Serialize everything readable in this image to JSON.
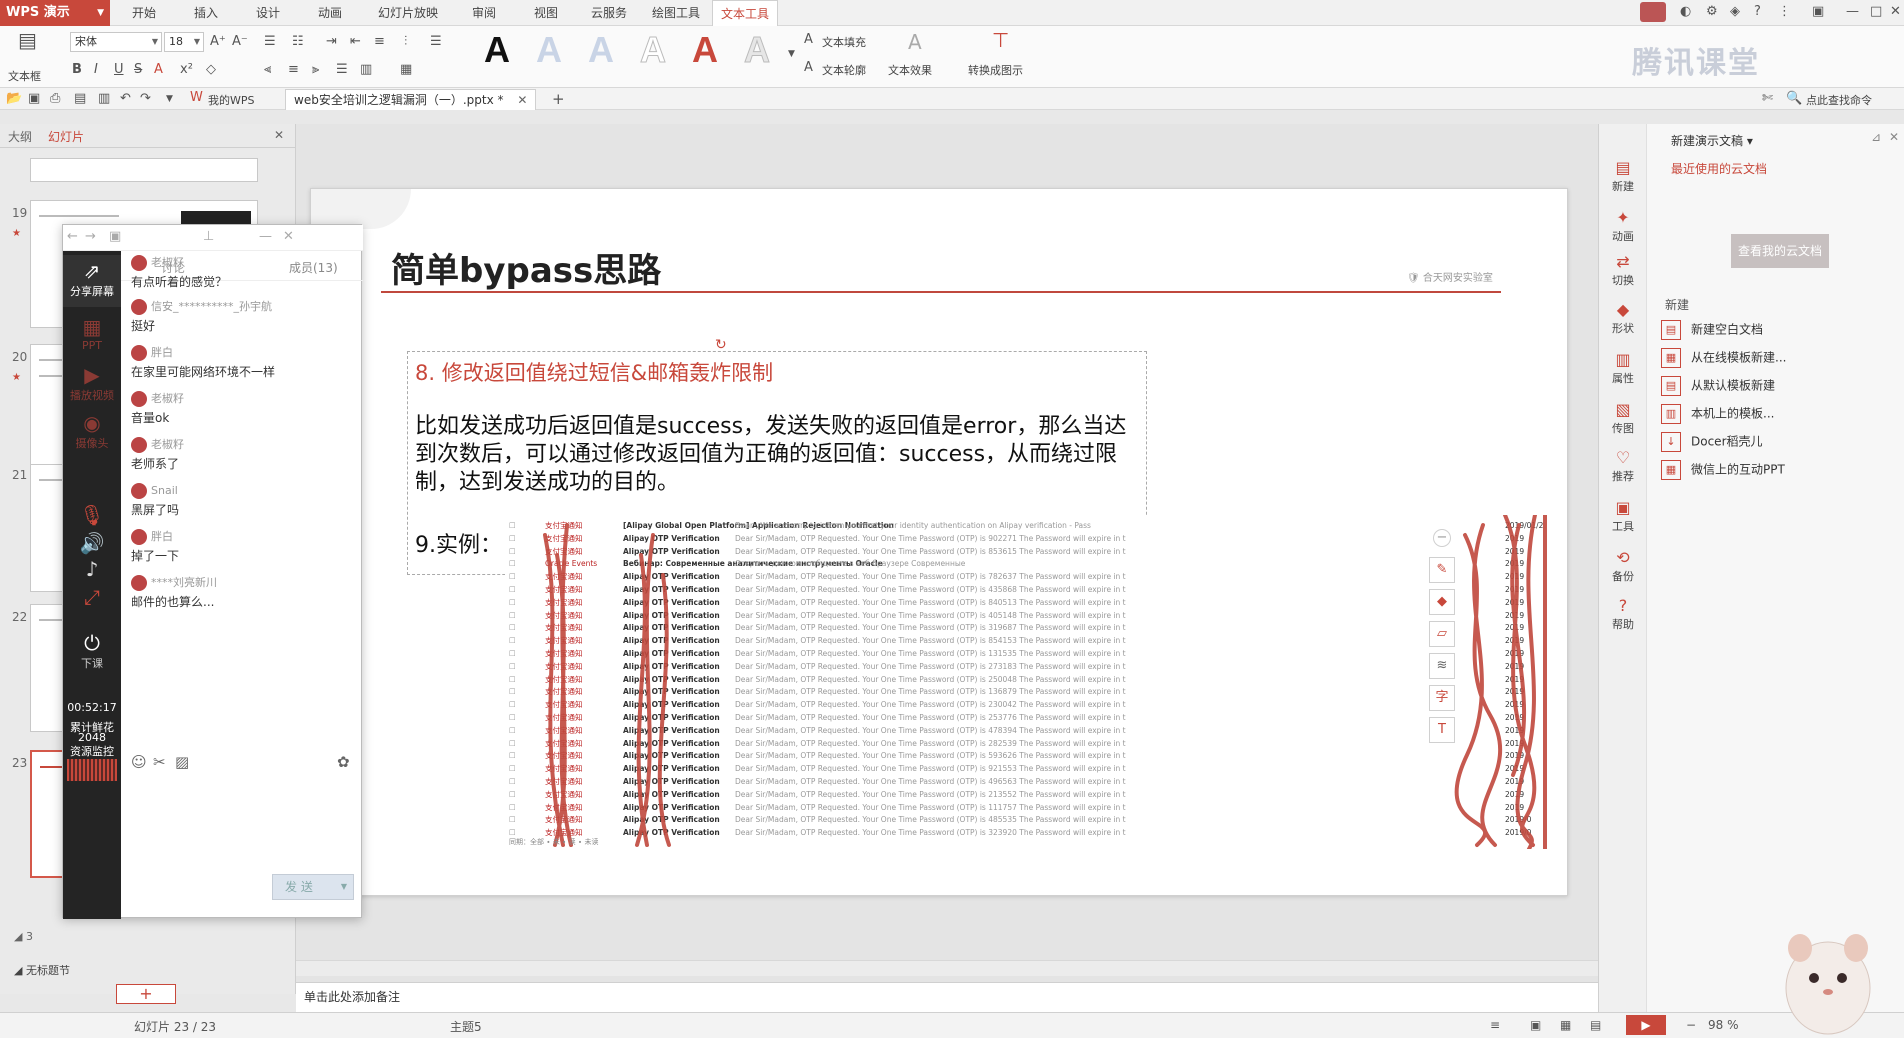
{
  "app": {
    "name": "WPS 演示"
  },
  "ribbon_tabs": [
    "开始",
    "插入",
    "设计",
    "动画",
    "幻灯片放映",
    "审阅",
    "视图",
    "云服务",
    "绘图工具",
    "文本工具"
  ],
  "ribbon": {
    "textbox_label": "文本框",
    "font_name": "宋体",
    "font_size": "18",
    "fill_label": "文本填充",
    "outline_label": "文本轮廓",
    "effect_label": "文本效果",
    "convert_label": "转换成图示",
    "wordart_colors": [
      "#111111",
      "#c9d4e6",
      "#c9d4e6",
      "#e8e8e8",
      "#c8483b",
      "#e6e6e6"
    ]
  },
  "qbar": {
    "mywps_label": "我的WPS",
    "doc_tab": "web安全培训之逻辑漏洞（一）.pptx *",
    "search_placeholder": "点此查找命令"
  },
  "left_pane": {
    "tab_outline": "大纲",
    "tab_slides": "幻灯片",
    "slide_numbers": [
      "19",
      "20",
      "21",
      "22",
      "23"
    ],
    "no_section": "无标题节",
    "add_slide": "+"
  },
  "chat": {
    "sidebar": {
      "share_screen": "分享屏幕",
      "ppt": "PPT",
      "play_video": "播放视频",
      "camera": "摄像头",
      "end_class": "下课",
      "timer": "00:52:17",
      "flowers_label": "累计鲜花",
      "flowers_count": "2048",
      "resource_label": "资源监控"
    },
    "tab_discuss": "讨论",
    "tab_members": "成员(13)",
    "messages": [
      {
        "who": "老椒籽",
        "text": "有点听着的感觉？"
      },
      {
        "who": "信安_**********_孙宇航",
        "text": "挺好"
      },
      {
        "who": "胖白",
        "text": "在家里可能网络环境不一样"
      },
      {
        "who": "老椒籽",
        "text": "音量ok"
      },
      {
        "who": "老椒籽",
        "text": "老师系了"
      },
      {
        "who": "Snail",
        "text": "黑屏了吗"
      },
      {
        "who": "胖白",
        "text": "掉了一下"
      },
      {
        "who": "****刘亮新川",
        "text": "邮件的也算么..."
      }
    ],
    "send_label": "发 送"
  },
  "slide": {
    "title": "简单bypass思路",
    "logo_text": "合天网安实验室",
    "item8": "8. 修改返回值绕过短信&邮箱轰炸限制",
    "body": "比如发送成功后返回值是success，发送失败的返回值是error，那么当达到次数后，可以通过修改返回值为正确的返回值：success，从而绕过限制，达到发送成功的目的。",
    "example_label": "9.实例：",
    "emails": [
      {
        "sender": "支付宝通知",
        "subject": "[Alipay Global Open Platform] Application Rejection Notification",
        "preview": "Dear , We are sorry to inform you that your identity authentication on Alipay verification - Pass",
        "date": "2019/01/2"
      },
      {
        "sender": "支付宝通知",
        "subject": "Alipay OTP Verification",
        "preview": "Dear Sir/Madam, OTP Requested. Your One Time Password (OTP) is 902271 The Password will expire in t",
        "date": "2019"
      },
      {
        "sender": "支付宝通知",
        "subject": "Alipay OTP Verification",
        "preview": "Dear Sir/Madam, OTP Requested. Your One Time Password (OTP) is 853615 The Password will expire in t",
        "date": "2019"
      },
      {
        "sender": "Oracle Events",
        "subject": "Вебинар: Современные аналитические инструменты Oracle",
        "preview": "Открыть данное сообщение в веб-браузере Современные",
        "date": "2019"
      },
      {
        "sender": "支付宝通知",
        "subject": "Alipay OTP Verification",
        "preview": "Dear Sir/Madam, OTP Requested. Your One Time Password (OTP) is 782637 The Password will expire in t",
        "date": "2019"
      },
      {
        "sender": "支付宝通知",
        "subject": "Alipay OTP Verification",
        "preview": "Dear Sir/Madam, OTP Requested. Your One Time Password (OTP) is 435868 The Password will expire in t",
        "date": "2019"
      },
      {
        "sender": "支付宝通知",
        "subject": "Alipay OTP Verification",
        "preview": "Dear Sir/Madam, OTP Requested. Your One Time Password (OTP) is 840513 The Password will expire in t",
        "date": "2019"
      },
      {
        "sender": "支付宝通知",
        "subject": "Alipay OTP Verification",
        "preview": "Dear Sir/Madam, OTP Requested. Your One Time Password (OTP) is 405148 The Password will expire in t",
        "date": "2019"
      },
      {
        "sender": "支付宝通知",
        "subject": "Alipay OTP Verification",
        "preview": "Dear Sir/Madam, OTP Requested. Your One Time Password (OTP) is 319687 The Password will expire in t",
        "date": "2019"
      },
      {
        "sender": "支付宝通知",
        "subject": "Alipay OTP Verification",
        "preview": "Dear Sir/Madam, OTP Requested. Your One Time Password (OTP) is 854153 The Password will expire in t",
        "date": "2019"
      },
      {
        "sender": "支付宝通知",
        "subject": "Alipay OTP Verification",
        "preview": "Dear Sir/Madam, OTP Requested. Your One Time Password (OTP) is 131535 The Password will expire in t",
        "date": "2019"
      },
      {
        "sender": "支付宝通知",
        "subject": "Alipay OTP Verification",
        "preview": "Dear Sir/Madam, OTP Requested. Your One Time Password (OTP) is 273183 The Password will expire in t",
        "date": "2019"
      },
      {
        "sender": "支付宝通知",
        "subject": "Alipay OTP Verification",
        "preview": "Dear Sir/Madam, OTP Requested. Your One Time Password (OTP) is 250048 The Password will expire in t",
        "date": "2019"
      },
      {
        "sender": "支付宝通知",
        "subject": "Alipay OTP Verification",
        "preview": "Dear Sir/Madam, OTP Requested. Your One Time Password (OTP) is 136879 The Password will expire in t",
        "date": "2019"
      },
      {
        "sender": "支付宝通知",
        "subject": "Alipay OTP Verification",
        "preview": "Dear Sir/Madam, OTP Requested. Your One Time Password (OTP) is 230042 The Password will expire in t",
        "date": "2019"
      },
      {
        "sender": "支付宝通知",
        "subject": "Alipay OTP Verification",
        "preview": "Dear Sir/Madam, OTP Requested. Your One Time Password (OTP) is 253776 The Password will expire in t",
        "date": "2019"
      },
      {
        "sender": "支付宝通知",
        "subject": "Alipay OTP Verification",
        "preview": "Dear Sir/Madam, OTP Requested. Your One Time Password (OTP) is 478394 The Password will expire in t",
        "date": "2019"
      },
      {
        "sender": "支付宝通知",
        "subject": "Alipay OTP Verification",
        "preview": "Dear Sir/Madam, OTP Requested. Your One Time Password (OTP) is 282539 The Password will expire in t",
        "date": "2019"
      },
      {
        "sender": "支付宝通知",
        "subject": "Alipay OTP Verification",
        "preview": "Dear Sir/Madam, OTP Requested. Your One Time Password (OTP) is 593626 The Password will expire in t",
        "date": "2019"
      },
      {
        "sender": "支付宝通知",
        "subject": "Alipay OTP Verification",
        "preview": "Dear Sir/Madam, OTP Requested. Your One Time Password (OTP) is 921553 The Password will expire in t",
        "date": "2019"
      },
      {
        "sender": "支付宝通知",
        "subject": "Alipay OTP Verification",
        "preview": "Dear Sir/Madam, OTP Requested. Your One Time Password (OTP) is 496563 The Password will expire in t",
        "date": "2019"
      },
      {
        "sender": "支付宝通知",
        "subject": "Alipay OTP Verification",
        "preview": "Dear Sir/Madam, OTP Requested. Your One Time Password (OTP) is 213552 The Password will expire in t",
        "date": "2019"
      },
      {
        "sender": "支付宝通知",
        "subject": "Alipay OTP Verification",
        "preview": "Dear Sir/Madam, OTP Requested. Your One Time Password (OTP) is 111757 The Password will expire in t",
        "date": "2019"
      },
      {
        "sender": "支付宝通知",
        "subject": "Alipay OTP Verification",
        "preview": "Dear Sir/Madam, OTP Requested. Your One Time Password (OTP) is 485535 The Password will expire in t",
        "date": "2019/0"
      },
      {
        "sender": "支付宝通知",
        "subject": "Alipay OTP Verification",
        "preview": "Dear Sir/Madam, OTP Requested. Your One Time Password (OTP) is 323920 The Password will expire in t",
        "date": "2019/0"
      }
    ],
    "email_footer": "同期：全部 ∙ 未 ∙ 读 ∙ 未读"
  },
  "notes_placeholder": "单击此处添加备注",
  "status": {
    "slide_count": "幻灯片 23 / 23",
    "theme": "主题5",
    "zoom": "98 %"
  },
  "taskpane": {
    "header": "新建演示文稿",
    "recent_cloud": "最近使用的云文档",
    "cloud_button": "查看我的云文档",
    "new_section": "新建",
    "icons": [
      "新建",
      "动画",
      "切换",
      "形状",
      "属性",
      "传图",
      "推荐",
      "工具",
      "备份",
      "帮助"
    ],
    "entries": [
      "新建空白文档",
      "从在线模板新建...",
      "从默认模板新建",
      "本机上的模板...",
      "Docer稻壳儿",
      "微信上的互动PPT"
    ]
  },
  "watermark": "腾讯课堂",
  "colors": {
    "accent": "#c8483b",
    "chat_sidebar": "#242424"
  }
}
